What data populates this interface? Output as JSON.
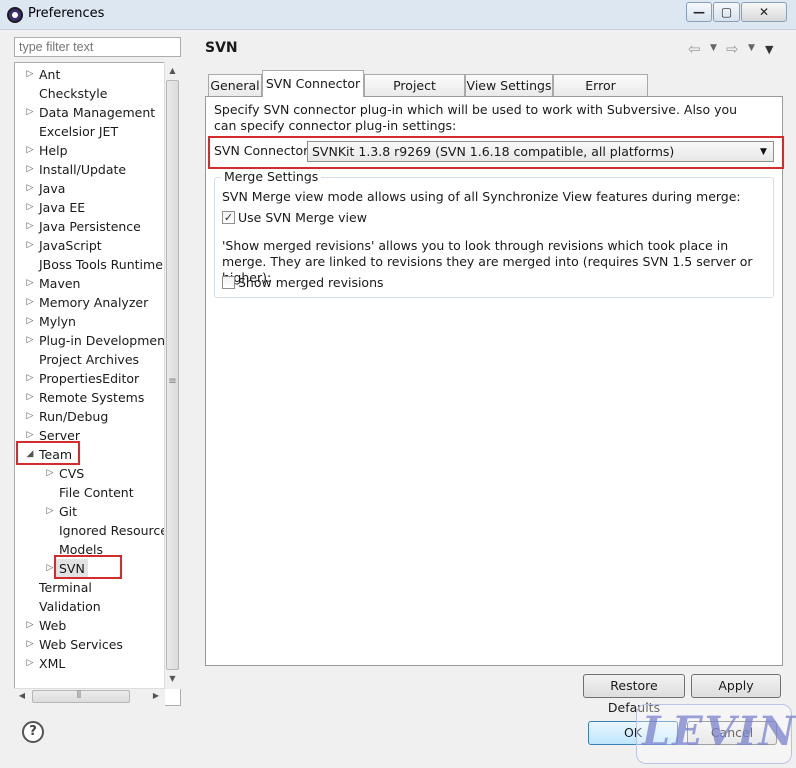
{
  "window": {
    "title": "Preferences"
  },
  "filter": {
    "placeholder": "type filter text"
  },
  "tree": [
    {
      "label": "Ant",
      "arrow": "▷",
      "indent": 0
    },
    {
      "label": "Checkstyle",
      "arrow": "",
      "indent": 0
    },
    {
      "label": "Data Management",
      "arrow": "▷",
      "indent": 0
    },
    {
      "label": "Excelsior JET",
      "arrow": "",
      "indent": 0
    },
    {
      "label": "Help",
      "arrow": "▷",
      "indent": 0
    },
    {
      "label": "Install/Update",
      "arrow": "▷",
      "indent": 0
    },
    {
      "label": "Java",
      "arrow": "▷",
      "indent": 0
    },
    {
      "label": "Java EE",
      "arrow": "▷",
      "indent": 0
    },
    {
      "label": "Java Persistence",
      "arrow": "▷",
      "indent": 0
    },
    {
      "label": "JavaScript",
      "arrow": "▷",
      "indent": 0
    },
    {
      "label": "JBoss Tools Runtime D",
      "arrow": "",
      "indent": 0
    },
    {
      "label": "Maven",
      "arrow": "▷",
      "indent": 0
    },
    {
      "label": "Memory Analyzer",
      "arrow": "▷",
      "indent": 0
    },
    {
      "label": "Mylyn",
      "arrow": "▷",
      "indent": 0
    },
    {
      "label": "Plug-in Development",
      "arrow": "▷",
      "indent": 0
    },
    {
      "label": "Project Archives",
      "arrow": "",
      "indent": 0
    },
    {
      "label": "PropertiesEditor",
      "arrow": "▷",
      "indent": 0
    },
    {
      "label": "Remote Systems",
      "arrow": "▷",
      "indent": 0
    },
    {
      "label": "Run/Debug",
      "arrow": "▷",
      "indent": 0
    },
    {
      "label": "Server",
      "arrow": "▷",
      "indent": 0
    },
    {
      "label": "Team",
      "arrow": "◢",
      "indent": 0,
      "highlight": true
    },
    {
      "label": "CVS",
      "arrow": "▷",
      "indent": 1
    },
    {
      "label": "File Content",
      "arrow": "",
      "indent": 1
    },
    {
      "label": "Git",
      "arrow": "▷",
      "indent": 1
    },
    {
      "label": "Ignored Resources",
      "arrow": "",
      "indent": 1
    },
    {
      "label": "Models",
      "arrow": "",
      "indent": 1
    },
    {
      "label": "SVN",
      "arrow": "▷",
      "indent": 1,
      "highlight": true,
      "selected": true
    },
    {
      "label": "Terminal",
      "arrow": "",
      "indent": 0
    },
    {
      "label": "Validation",
      "arrow": "",
      "indent": 0
    },
    {
      "label": "Web",
      "arrow": "▷",
      "indent": 0
    },
    {
      "label": "Web Services",
      "arrow": "▷",
      "indent": 0
    },
    {
      "label": "XML",
      "arrow": "▷",
      "indent": 0
    }
  ],
  "page": {
    "title": "SVN"
  },
  "tabs": [
    "General",
    "SVN Connector",
    "Project structure",
    "View Settings",
    "Error Reporting"
  ],
  "connector": {
    "description": "Specify SVN connector plug-in which will be used to work with Subversive. Also you can specify connector plug-in settings:",
    "label": "SVN Connector:",
    "value": "SVNKit 1.3.8 r9269 (SVN 1.6.18 compatible, all platforms)"
  },
  "merge": {
    "legend": "Merge Settings",
    "description": "SVN Merge view mode allows using of all Synchronize View features during merge:",
    "use_merge_view_label": "Use SVN Merge view",
    "use_merge_view_checked": true,
    "show_merged_description": "'Show merged revisions' allows you to look through revisions which took place in merge. They are linked to revisions they are merged into (requires SVN 1.5 server or higher):",
    "show_merged_label": "Show merged revisions",
    "show_merged_checked": false
  },
  "buttons": {
    "restore_defaults": "Restore Defaults",
    "apply": "Apply",
    "ok": "OK",
    "cancel": "Cancel"
  },
  "watermark": "LEVIN",
  "colors": {
    "highlight_border": "#d42b2b",
    "watermark": "#7882cd"
  }
}
